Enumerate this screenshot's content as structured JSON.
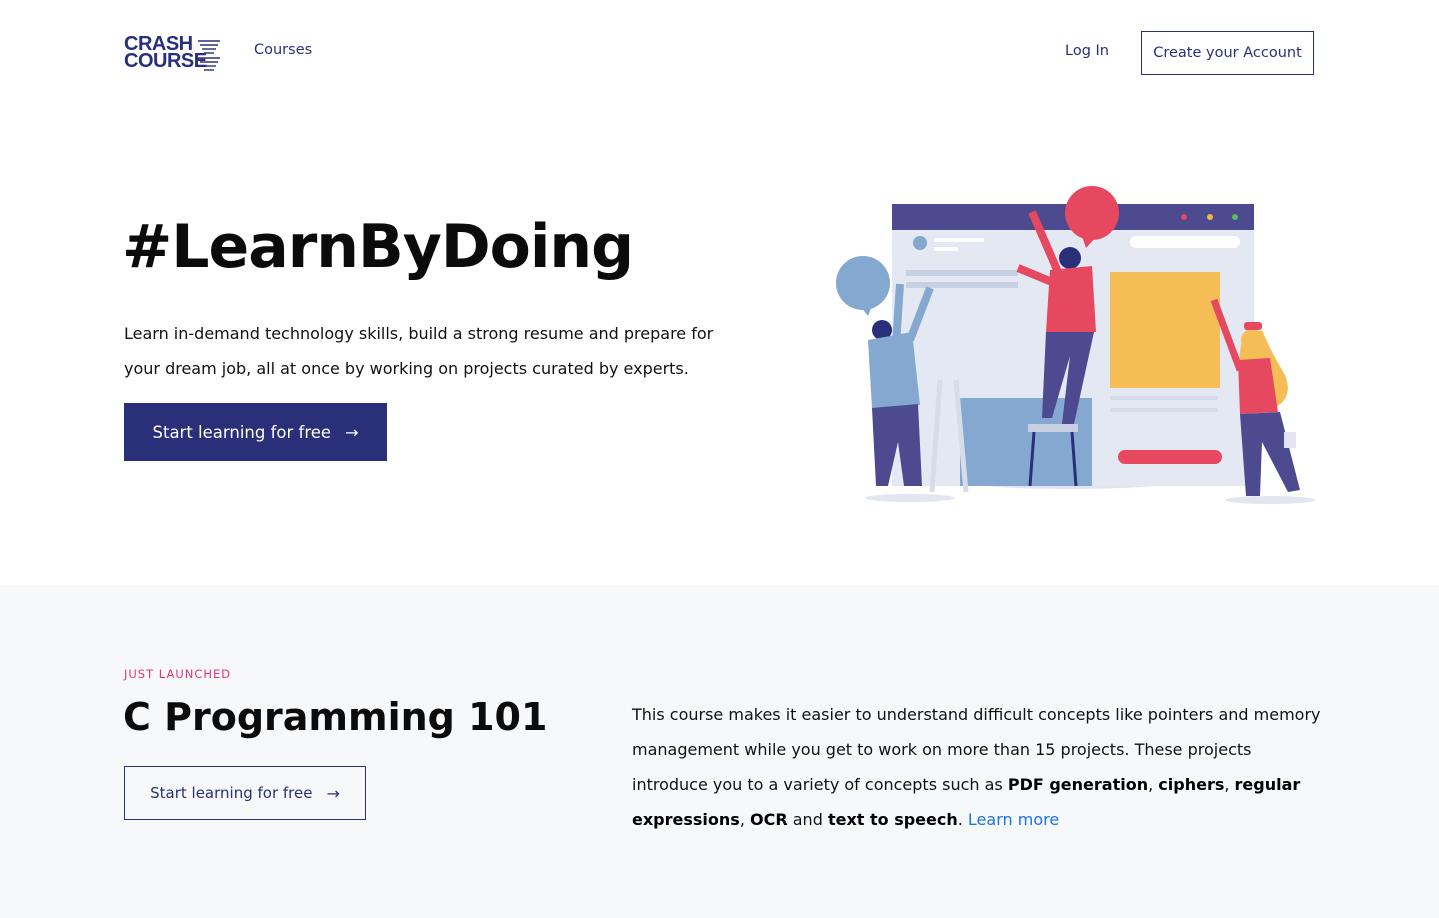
{
  "header": {
    "logo_line1": "CRASH",
    "logo_line2": "COURSE",
    "nav_courses": "Courses",
    "login": "Log In",
    "create_account": "Create your Account"
  },
  "hero": {
    "title": "#LearnByDoing",
    "subtitle": "Learn in-demand technology skills, build a strong resume and prepare for your dream job, all at once by working on projects curated by experts.",
    "cta": "Start learning for free",
    "cta_icon": "arrow-right-icon",
    "illustration": "team-building-webpage-illustration"
  },
  "featured": {
    "eyebrow": "JUST LAUNCHED",
    "title": "C Programming 101",
    "cta": "Start learning for free",
    "desc_intro": "This course makes it easier to understand difficult concepts like pointers and memory management while you get to work on more than 15 projects. These projects introduce you to a variety of concepts such as ",
    "topic1": "PDF generation",
    "sep1": ", ",
    "topic2": "ciphers",
    "sep2": ", ",
    "topic3": "regular expressions",
    "sep3": ", ",
    "topic4": "OCR",
    "and": " and ",
    "topic5": "text to speech",
    "period": ". ",
    "learn_more": "Learn more"
  },
  "colors": {
    "brand": "#2a2f7a",
    "accent_pink": "#e0377a",
    "link": "#1a73e8",
    "section_bg": "#f7f8fa"
  }
}
